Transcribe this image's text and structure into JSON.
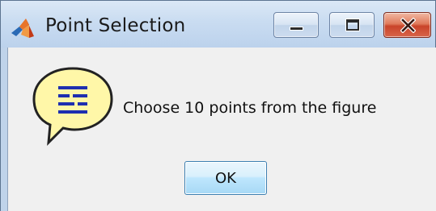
{
  "window": {
    "title": "Point Selection",
    "controls": {
      "minimize": "minimize-icon",
      "maximize": "maximize-icon",
      "close": "close-icon"
    }
  },
  "dialog": {
    "icon": "help-speech-bubble-icon",
    "message": "Choose 10 points from the figure",
    "ok_label": "OK"
  },
  "colors": {
    "titlebar": "#c9dcf1",
    "client_background": "#f0f0f0",
    "close_button": "#d8654a",
    "bubble_fill": "#fff7a8",
    "bubble_lines": "#1e2fb0"
  }
}
